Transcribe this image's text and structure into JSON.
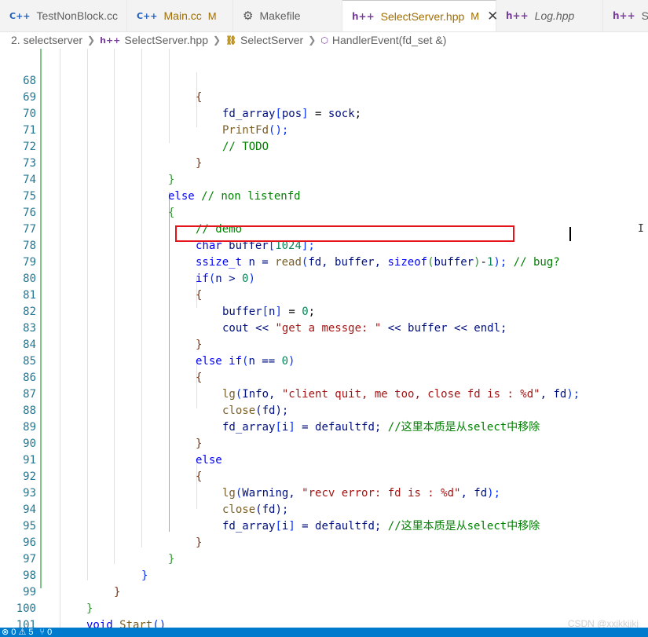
{
  "tabs": [
    {
      "icon": "C++",
      "name": "TestNonBlock.cc",
      "mark": "",
      "modified": false,
      "italic": false
    },
    {
      "icon": "C++",
      "name": "Main.cc",
      "mark": "M",
      "modified": true,
      "italic": false
    },
    {
      "icon": "⚙",
      "name": "Makefile",
      "mark": "",
      "modified": false,
      "italic": false
    },
    {
      "icon": "h++",
      "name": "SelectServer.hpp",
      "mark": "M",
      "modified": true,
      "italic": false
    },
    {
      "icon": "h++",
      "name": "Log.hpp",
      "mark": "",
      "modified": false,
      "italic": true
    },
    {
      "icon": "h++",
      "name": "Soc",
      "mark": "",
      "modified": false,
      "italic": false
    }
  ],
  "close_glyph": "✕",
  "breadcrumb": {
    "folder": "2. selectserver",
    "file": "SelectServer.hpp",
    "class": "SelectServer",
    "method": "HandlerEvent(fd_set &)"
  },
  "code_lines": [
    {
      "n": "68"
    },
    {
      "n": "69"
    },
    {
      "n": "70"
    },
    {
      "n": "71"
    },
    {
      "n": "72"
    },
    {
      "n": "73"
    },
    {
      "n": "74"
    },
    {
      "n": "75"
    },
    {
      "n": "76"
    },
    {
      "n": "77"
    },
    {
      "n": "78"
    },
    {
      "n": "79"
    },
    {
      "n": "80"
    },
    {
      "n": "81"
    },
    {
      "n": "82"
    },
    {
      "n": "83"
    },
    {
      "n": "84"
    },
    {
      "n": "85"
    },
    {
      "n": "86"
    },
    {
      "n": "87"
    },
    {
      "n": "88"
    },
    {
      "n": "89"
    },
    {
      "n": "90"
    },
    {
      "n": "91"
    },
    {
      "n": "92"
    },
    {
      "n": "93"
    },
    {
      "n": "94"
    },
    {
      "n": "95"
    },
    {
      "n": "96"
    },
    {
      "n": "97"
    },
    {
      "n": "98"
    },
    {
      "n": "99"
    },
    {
      "n": "100"
    },
    {
      "n": "101"
    }
  ],
  "code": {
    "l68": "{",
    "l69_a": "fd_array",
    "l69_b": "[",
    "l69_c": "pos",
    "l69_d": "]",
    "l69_e": " = ",
    "l69_f": "sock",
    ";": ";",
    "l70_a": "PrintFd",
    "l70_b": "();",
    "l71": "// TODO",
    "l72": "}",
    "l73": "}",
    "l74_kw": "else",
    "l74_cm": " // non listenfd",
    "l75": "{",
    "l76": "// demo",
    "l77_kw": "char",
    "l77_var": " buffer",
    "l77_b": "[",
    "l77_num": "1024",
    "l77_e": "];",
    "l78_ty": "ssize_t",
    "l78_n": " n = ",
    "l78_fn": "read",
    "l78_p1": "(",
    "l78_args": "fd, buffer, ",
    "l78_kw": "sizeof",
    "l78_p2": "(",
    "l78_buf": "buffer",
    "l78_p3": ")",
    "l78_minus": "-",
    "l78_one": "1",
    "l78_p4": ");",
    "l78_cm": " // bug?",
    "l79_kw": "if",
    "l79_p": "(",
    "l79_n": "n > ",
    "l79_z": "0",
    "l79_q": ")",
    "l80": "{",
    "l81_a": "buffer",
    "l81_b": "[",
    "l81_c": "n",
    "l81_d": "]",
    "l81_e": " = ",
    "l81_z": "0",
    "l82_a": "cout << ",
    "l82_s": "\"get a messge: \"",
    "l82_b": " << buffer << endl;",
    "l83": "}",
    "l84_kw": "else if",
    "l84_p": "(",
    "l84_n": "n == ",
    "l84_z": "0",
    "l84_q": ")",
    "l85": "{",
    "l86_fn": "lg",
    "l86_p": "(",
    "l86_a": "Info, ",
    "l86_s": "\"client quit, me too, close fd is : %d\"",
    "l86_b": ", fd",
    ");": ");",
    "l87_fn": "close",
    "l87_a": "(fd);",
    "l88_a": "fd_array",
    "l88_b": "[",
    "l88_c": "i",
    "l88_d": "]",
    "l88_e": " = defaultfd; ",
    "l88_cm": "//这里本质是从select中移除",
    "l89": "}",
    "l90": "else",
    "l91": "{",
    "l92_fn": "lg",
    "l92_p": "(",
    "l92_a": "Warning, ",
    "l92_s": "\"recv error: fd is : %d\"",
    "l92_b": ", fd",
    "l93_fn": "close",
    "l93_a": "(fd);",
    "l94_a": "fd_array",
    "l94_b": "[",
    "l94_c": "i",
    "l94_d": "]",
    "l94_e": " = defaultfd; ",
    "l94_cm": "//这里本质是从select中移除",
    "l95": "}",
    "l96": "}",
    "l97": "}",
    "l98": "}",
    "l99": "}",
    "l100_kw": "void",
    "l100_fn": " Start",
    "l100_p": "()",
    "l101": "{"
  },
  "status": {
    "left": "⊗ 0 ⚠ 5",
    "right": "⑂ 0"
  },
  "watermark": "CSDN @xxjkkjjkj",
  "colors": {
    "accent": "#007acc",
    "highlight_border": "#e5141a",
    "modified": "#a16d00"
  }
}
